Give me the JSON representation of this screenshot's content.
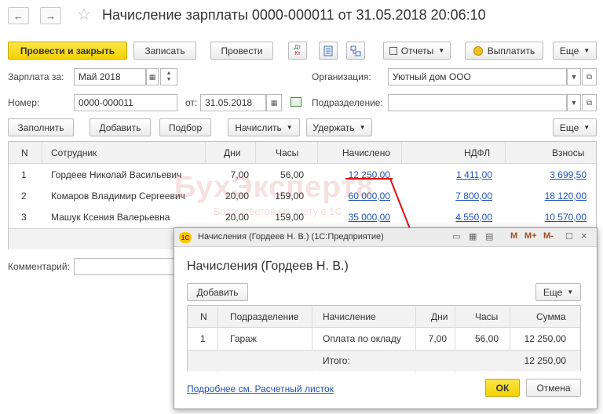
{
  "window": {
    "title": "Начисление зарплаты 0000-000011 от 31.05.2018 20:06:10",
    "back_glyph": "←",
    "forward_glyph": "→",
    "star_glyph": "☆"
  },
  "toolbar": {
    "post_close": "Провести и закрыть",
    "save": "Записать",
    "post": "Провести",
    "reports": "Отчеты",
    "pay": "Выплатить",
    "more": "Еще",
    "dt_label": "Дт",
    "kt_label": "Кт"
  },
  "form": {
    "salary_for_label": "Зарплата за:",
    "salary_for_value": "Май 2018",
    "org_label": "Организация:",
    "org_value": "Уютный дом ООО",
    "number_label": "Номер:",
    "number_value": "0000-000011",
    "from_label": "от:",
    "date_value": "31.05.2018",
    "subdivision_label": "Подразделение:",
    "subdivision_value": "",
    "comment_label": "Комментарий:",
    "comment_value": ""
  },
  "table_toolbar": {
    "fill": "Заполнить",
    "add": "Добавить",
    "select": "Подбор",
    "accrue": "Начислить",
    "withhold": "Удержать",
    "more": "Еще"
  },
  "table": {
    "headers": [
      "N",
      "Сотрудник",
      "Дни",
      "Часы",
      "Начислено",
      "НДФЛ",
      "Взносы"
    ],
    "rows": [
      {
        "n": "1",
        "employee": "Гордеев Николай Васильевич",
        "days": "7,00",
        "hours": "56,00",
        "accrued": "12 250,00",
        "ndfl": "1 411,00",
        "contrib": "3 699,50"
      },
      {
        "n": "2",
        "employee": "Комаров Владимир Сергеевич",
        "days": "20,00",
        "hours": "159,00",
        "accrued": "60 000,00",
        "ndfl": "7 800,00",
        "contrib": "18 120,00"
      },
      {
        "n": "3",
        "employee": "Машук Ксения Валерьевна",
        "days": "20,00",
        "hours": "159,00",
        "accrued": "35 000,00",
        "ndfl": "4 550,00",
        "contrib": "10 570,00"
      }
    ]
  },
  "watermark": {
    "brand": "БухЭксперт8",
    "tagline": "База ответов по учету в 1С"
  },
  "modal": {
    "window_title": "Начисления (Гордеев Н. В.)  (1С:Предприятие)",
    "logo_text": "1С",
    "heading": "Начисления (Гордеев Н. В.)",
    "add": "Добавить",
    "more": "Еще",
    "headers": [
      "N",
      "Подразделение",
      "Начисление",
      "Дни",
      "Часы",
      "Сумма"
    ],
    "rows": [
      {
        "n": "1",
        "subdivision": "Гараж",
        "accrual": "Оплата по окладу",
        "days": "7,00",
        "hours": "56,00",
        "sum": "12 250,00"
      }
    ],
    "total_label": "Итого:",
    "total_sum": "12 250,00",
    "link": "Подробнее см. Расчетный листок",
    "ok": "ОК",
    "cancel": "Отмена",
    "m_label": "M",
    "m_plus_label": "M+",
    "m_minus_label": "M-"
  }
}
